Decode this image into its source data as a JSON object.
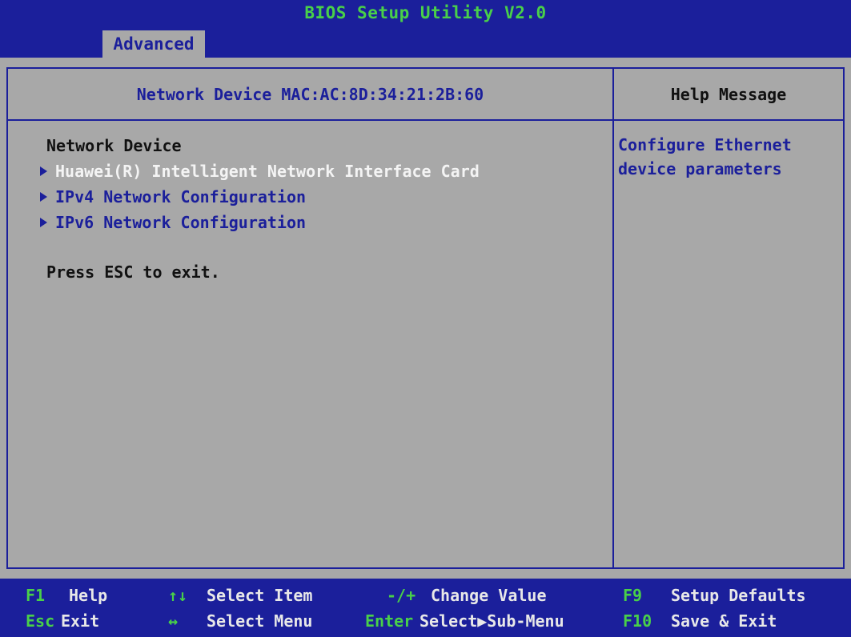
{
  "header": {
    "title": "BIOS Setup Utility V2.0",
    "active_tab": "Advanced"
  },
  "main": {
    "section_title": "Network Device MAC:AC:8D:34:21:2B:60",
    "heading": "Network Device",
    "items": [
      {
        "label": "Huawei(R) Intelligent Network Interface Card",
        "selected": true
      },
      {
        "label": "IPv4 Network Configuration",
        "selected": false
      },
      {
        "label": "IPv6 Network Configuration",
        "selected": false
      }
    ],
    "hint": "Press ESC to exit."
  },
  "help": {
    "title": "Help Message",
    "text": "Configure Ethernet\ndevice parameters"
  },
  "footer": {
    "f1_key": "F1",
    "f1_label": "Help",
    "updown_key": "↑↓",
    "updown_label": "Select Item",
    "plusminus_key": "-/+",
    "plusminus_label": "Change Value",
    "f9_key": "F9",
    "f9_label": "Setup Defaults",
    "esc_key": "Esc",
    "esc_label": "Exit",
    "leftright_key": "↔",
    "leftright_label": "Select Menu",
    "enter_key": "Enter",
    "enter_label": "Select▶Sub-Menu",
    "f10_key": "F10",
    "f10_label": "Save & Exit"
  },
  "colors": {
    "blue": "#1b1f9b",
    "green": "#49d049",
    "gray": "#a8a8a8",
    "white": "#f4f4f4"
  },
  "icons": {
    "item_arrow": "right-triangle-icon"
  }
}
